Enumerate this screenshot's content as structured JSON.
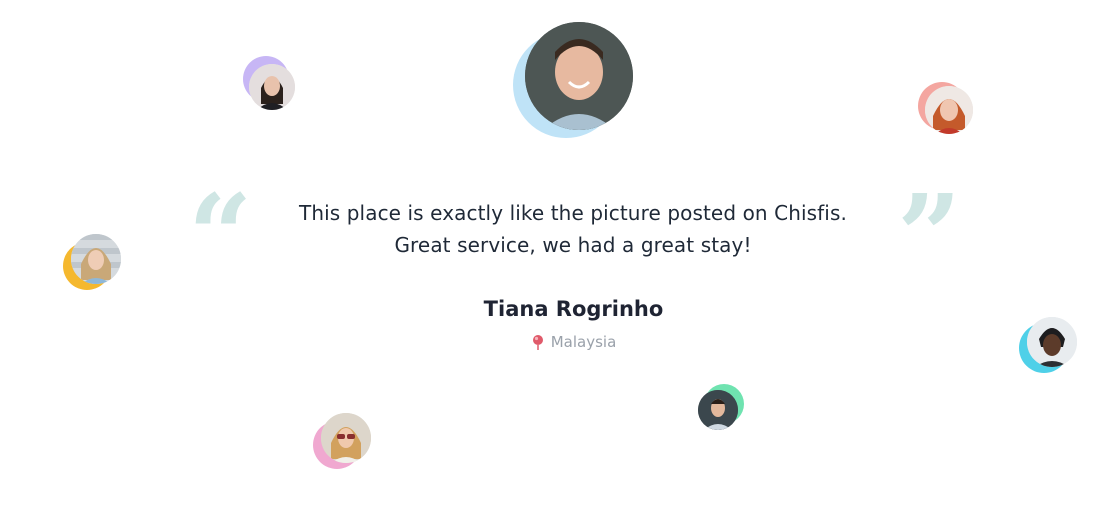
{
  "testimonial": {
    "quote_line_1": "This place is exactly like the picture posted on Chisfis.",
    "quote_line_2": "Great service, we had a great stay!",
    "name": "Tiana Rogrinho",
    "location": "Malaysia",
    "location_icon": "map-pin-icon",
    "open_quote": "“",
    "close_quote": "”"
  },
  "colors": {
    "quote_mark": "#cfe6e4",
    "ring_main": "#bfe3f7",
    "ring_purple": "#c7b6f5",
    "ring_red": "#f4a6a0",
    "ring_yellow": "#f5b82e",
    "ring_cyan": "#4fd0e8",
    "ring_green": "#6fe3b0",
    "ring_pink": "#f0a8d0",
    "pin": "#e05a6a"
  }
}
